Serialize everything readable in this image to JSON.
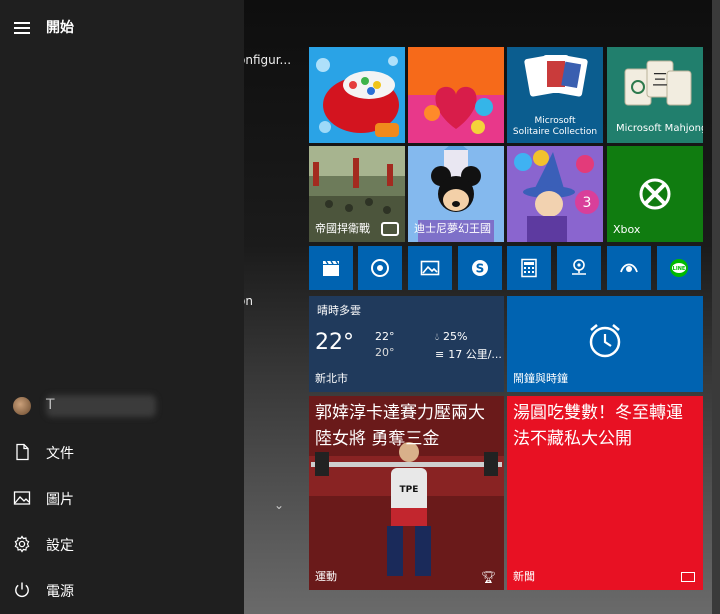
{
  "start": {
    "title": "開始"
  },
  "applist": {
    "fragment_1": "onfigur...",
    "fragment_2": "on"
  },
  "nav": {
    "user": {
      "name": "T"
    },
    "items": [
      {
        "label": "文件",
        "icon": "document-icon"
      },
      {
        "label": "圖片",
        "icon": "pictures-icon"
      },
      {
        "label": "設定",
        "icon": "gear-icon"
      },
      {
        "label": "電源",
        "icon": "power-icon"
      }
    ]
  },
  "tiles": {
    "solitaire": {
      "line1": "Microsoft",
      "line2": "Solitaire Collection"
    },
    "mahjong": {
      "label": "Microsoft Mahjong"
    },
    "empire": {
      "label": "帝國捍衛戰"
    },
    "disney": {
      "label": "迪士尼夢幻王國"
    },
    "xbox": {
      "label": "Xbox"
    },
    "weather": {
      "condition": "晴時多雲",
      "temperature": "22°",
      "high": "22°",
      "low": "20°",
      "rain": "25%",
      "wind": "17 公里/...",
      "location": "新北市"
    },
    "alarms": {
      "label": "鬧鐘與時鐘"
    },
    "sports": {
      "headline": "郭婞淳卡達賽力壓兩大陸女將 勇奪三金",
      "label": "運動"
    },
    "news": {
      "headline": "湯圓吃雙數！冬至轉運法不藏私大公開",
      "label": "新聞"
    }
  },
  "colors": {
    "tile_blue": "#0063b1",
    "xbox_green": "#107c10",
    "news_red": "#e81123",
    "weather_bg": "#1f3a5f",
    "nav_bg": "#1f1f1f"
  }
}
